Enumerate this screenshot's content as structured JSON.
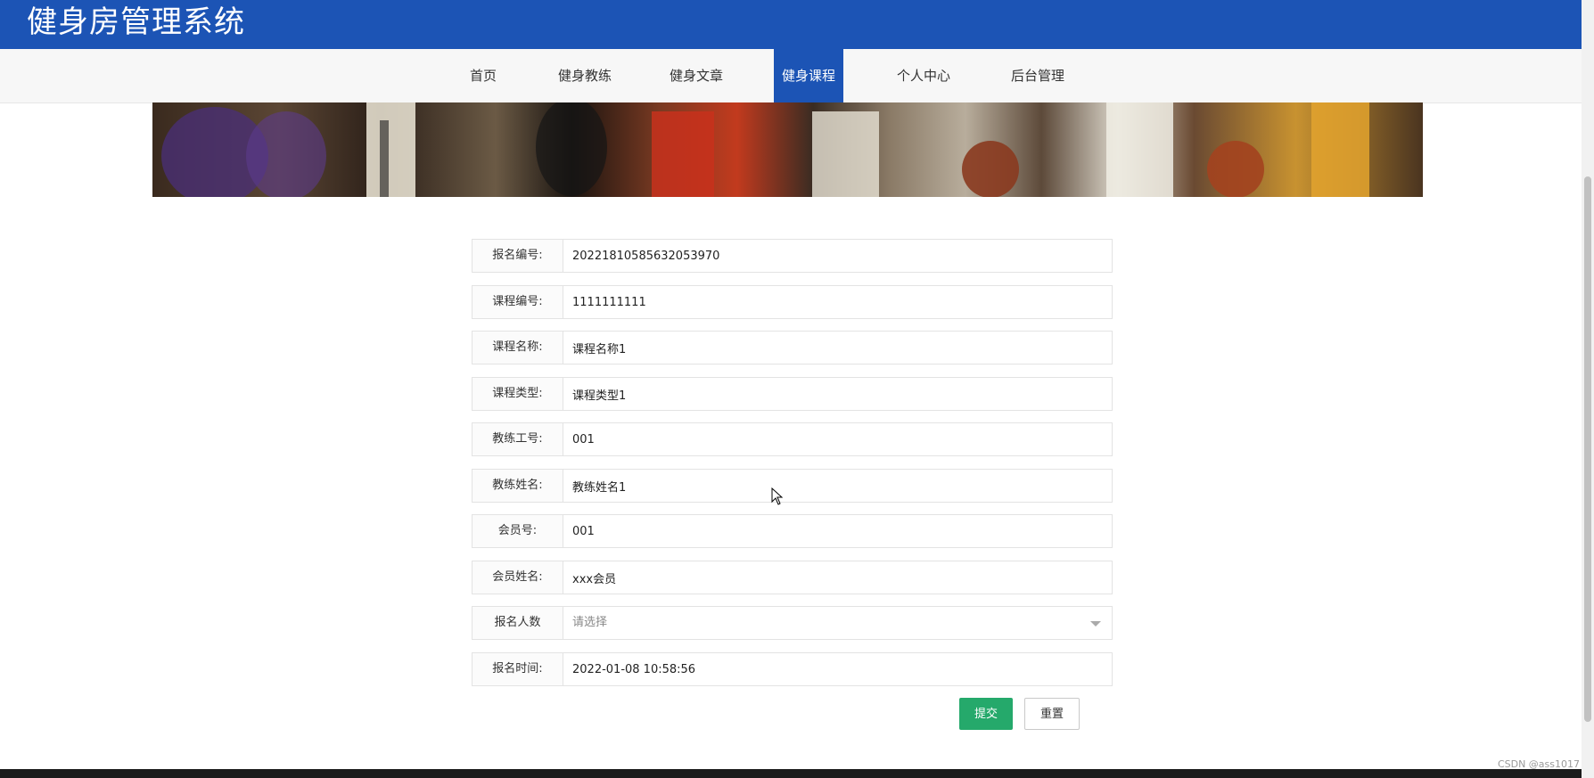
{
  "app": {
    "title": "健身房管理系统"
  },
  "nav": {
    "items": [
      {
        "label": "首页"
      },
      {
        "label": "健身教练"
      },
      {
        "label": "健身文章"
      },
      {
        "label": "健身课程",
        "active": true
      },
      {
        "label": "个人中心"
      },
      {
        "label": "后台管理"
      }
    ]
  },
  "form": {
    "fields": [
      {
        "label": "报名编号:",
        "value": "20221810585632053970"
      },
      {
        "label": "课程编号:",
        "value": "1111111111"
      },
      {
        "label": "课程名称:",
        "value": "课程名称1"
      },
      {
        "label": "课程类型:",
        "value": "课程类型1"
      },
      {
        "label": "教练工号:",
        "value": "001"
      },
      {
        "label": "教练姓名:",
        "value": "教练姓名1"
      },
      {
        "label": "会员号:",
        "value": "001"
      },
      {
        "label": "会员姓名:",
        "value": "xxx会员"
      },
      {
        "label": "报名人数",
        "placeholder": "请选择"
      },
      {
        "label": "报名时间:",
        "value": "2022-01-08 10:58:56"
      }
    ],
    "submit_label": "提交",
    "reset_label": "重置"
  },
  "watermark": "CSDN @ass1017",
  "colors": {
    "brand": "#1c54b5",
    "submit": "#25a96b"
  }
}
